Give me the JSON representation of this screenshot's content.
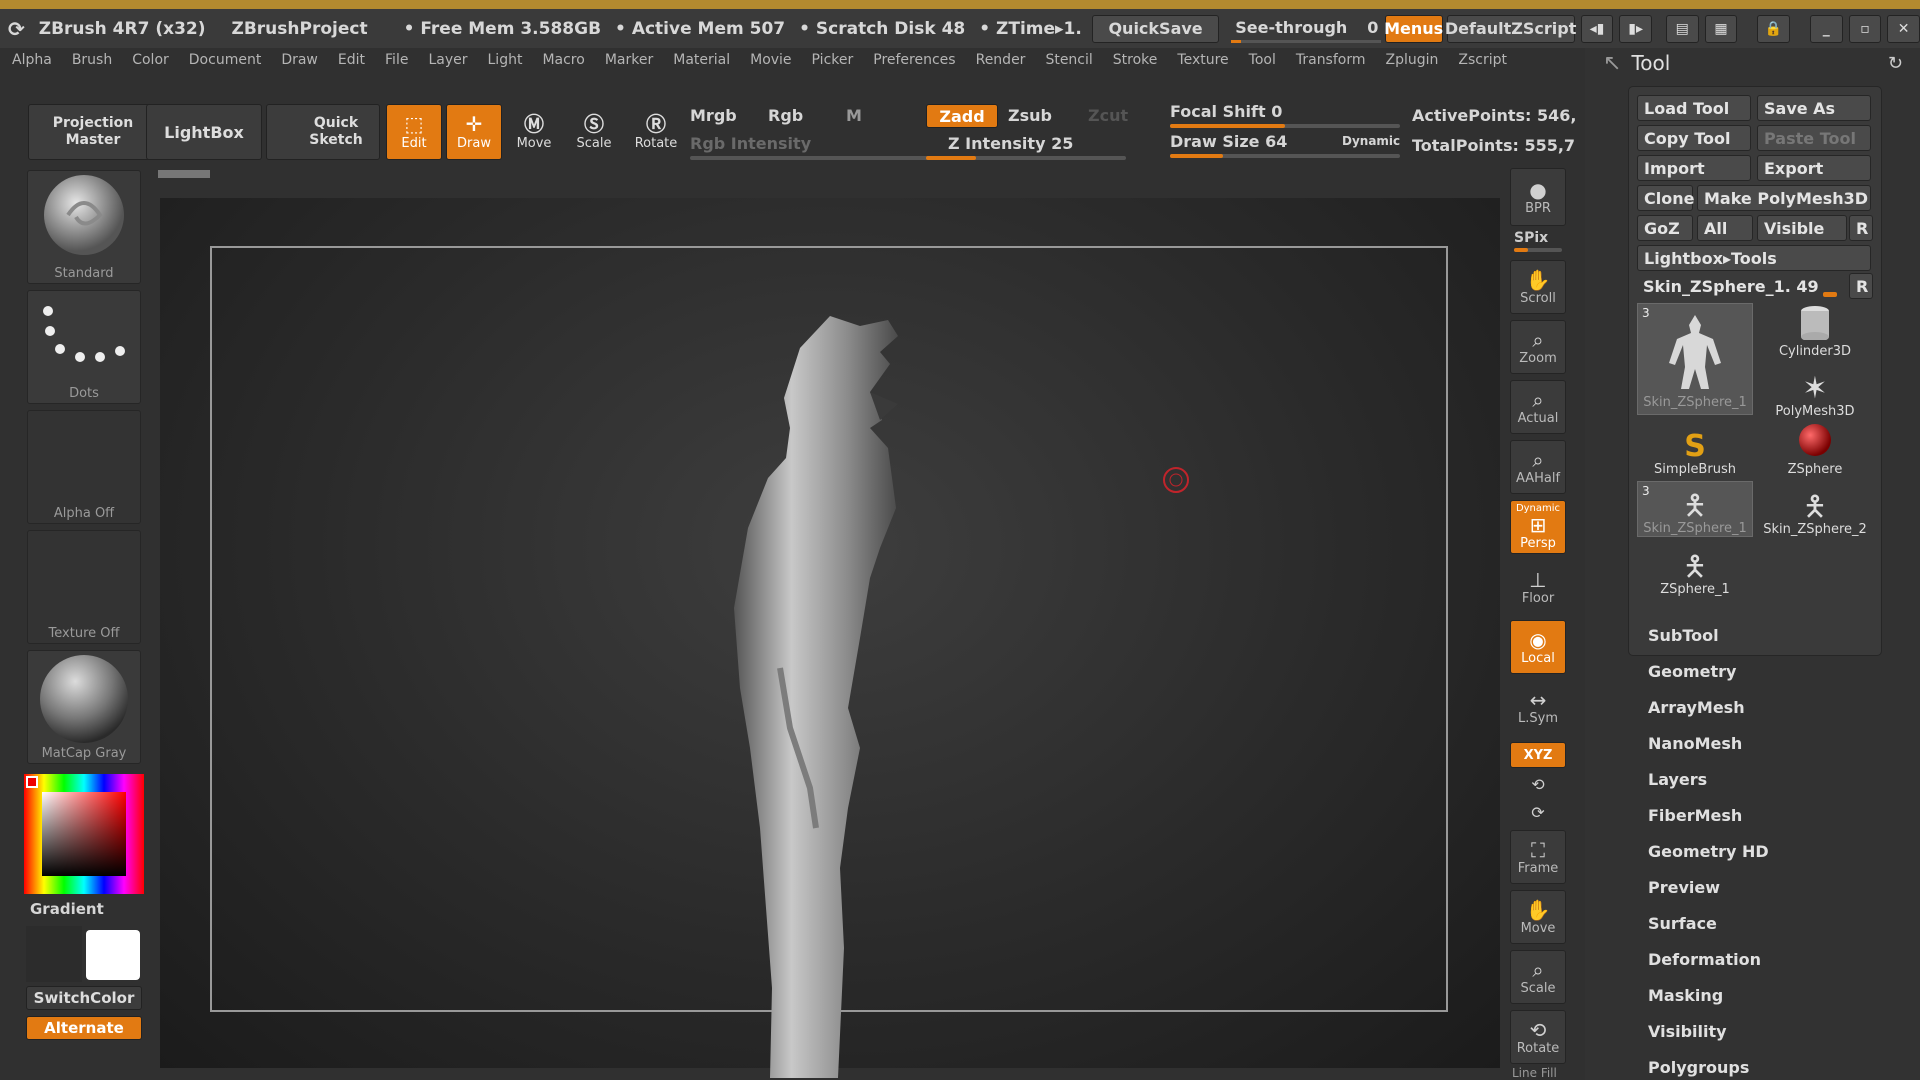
{
  "titlebar": {
    "app": "ZBrush 4R7 (x32)",
    "project": "ZBrushProject",
    "free_mem": "• Free Mem 3.588GB",
    "active_mem": "• Active Mem 507",
    "scratch_disk": "• Scratch Disk 48",
    "ztime": "• ZTime▸1.",
    "quicksave": "QuickSave",
    "see_through_label": "See-through",
    "see_through_value": "0",
    "menus": "Menus",
    "default_zscript": "DefaultZScript"
  },
  "menubar": [
    "Alpha",
    "Brush",
    "Color",
    "Document",
    "Draw",
    "Edit",
    "File",
    "Layer",
    "Light",
    "Macro",
    "Marker",
    "Material",
    "Movie",
    "Picker",
    "Preferences",
    "Render",
    "Stencil",
    "Stroke",
    "Texture",
    "Tool",
    "Transform",
    "Zplugin",
    "Zscript"
  ],
  "shelf": {
    "projection_master": "Projection Master",
    "lightbox": "LightBox",
    "quick_sketch": "Quick Sketch",
    "edit": "Edit",
    "draw": "Draw",
    "move": "Move",
    "scale": "Scale",
    "rotate": "Rotate",
    "mrgb": "Mrgb",
    "rgb": "Rgb",
    "m": "M",
    "rgb_intensity": "Rgb Intensity",
    "zadd": "Zadd",
    "zsub": "Zsub",
    "zcut": "Zcut",
    "z_intensity": "Z Intensity 25",
    "z_intensity_value": 25,
    "focal_shift": "Focal Shift 0",
    "focal_shift_value": 0,
    "draw_size": "Draw Size 64",
    "draw_size_value": 64,
    "dynamic": "Dynamic",
    "active_points": "ActivePoints: 546,",
    "total_points": "TotalPoints: 555,7"
  },
  "leftshelf": {
    "brush": "Standard",
    "stroke": "Dots",
    "alpha": "Alpha Off",
    "texture": "Texture Off",
    "material": "MatCap Gray",
    "gradient": "Gradient",
    "switchcolor": "SwitchColor",
    "alternate": "Alternate"
  },
  "rightstrip": {
    "bpr": "BPR",
    "spix": "SPix",
    "scroll": "Scroll",
    "zoom": "Zoom",
    "actual": "Actual",
    "aahalf": "AAHalf",
    "dynamic": "Dynamic",
    "persp": "Persp",
    "floor": "Floor",
    "local": "Local",
    "lsym": "L.Sym",
    "xyz": "XYZ",
    "frame": "Frame",
    "move": "Move",
    "scale": "Scale",
    "rotate": "Rotate",
    "line_fill": "Line Fill"
  },
  "toolpanel": {
    "title": "Tool",
    "load_tool": "Load Tool",
    "save_as": "Save As",
    "copy_tool": "Copy Tool",
    "paste_tool": "Paste Tool",
    "import": "Import",
    "export": "Export",
    "clone": "Clone",
    "make_polymesh": "Make PolyMesh3D",
    "goz": "GoZ",
    "all": "All",
    "visible": "Visible",
    "r": "R",
    "lightbox_tools": "Lightbox▸Tools",
    "current_tool": "Skin_ZSphere_1. 49",
    "thumbs": [
      {
        "label": "Skin_ZSphere_1",
        "count": "3"
      },
      {
        "label": "Cylinder3D"
      },
      {
        "label": "PolyMesh3D"
      },
      {
        "label": "SimpleBrush"
      },
      {
        "label": "ZSphere"
      },
      {
        "label": "Skin_ZSphere_1",
        "count": "3"
      },
      {
        "label": "Skin_ZSphere_2"
      },
      {
        "label": "ZSphere_1"
      }
    ],
    "sections": [
      "SubTool",
      "Geometry",
      "ArrayMesh",
      "NanoMesh",
      "Layers",
      "FiberMesh",
      "Geometry HD",
      "Preview",
      "Surface",
      "Deformation",
      "Masking",
      "Visibility",
      "Polygroups"
    ]
  },
  "colors": {
    "accent": "#e27a12",
    "title_stripe": "#b38a2f",
    "panel": "#3a3a3a"
  }
}
